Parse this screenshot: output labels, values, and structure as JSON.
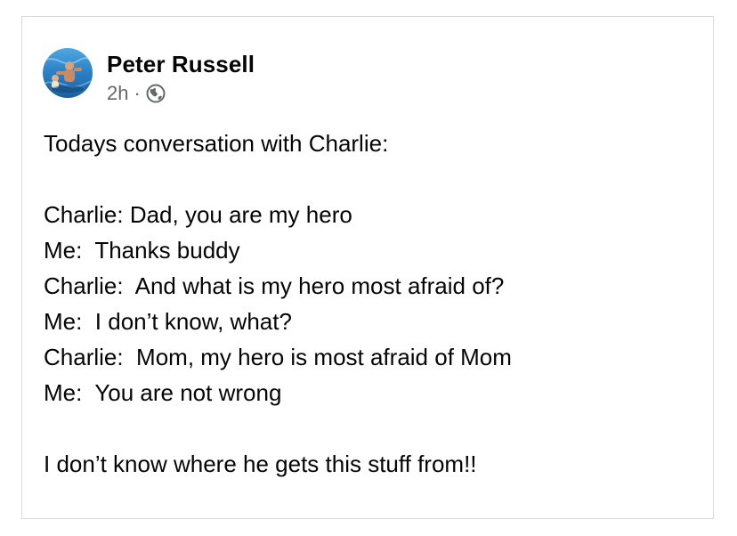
{
  "post": {
    "author": "Peter Russell",
    "timestamp": "2h",
    "separator": "·",
    "audience_icon": "globe-icon",
    "body_lines": [
      "Todays conversation with Charlie:",
      "",
      "Charlie: Dad, you are my hero",
      "Me:  Thanks buddy",
      "Charlie:  And what is my hero most afraid of?",
      "Me:  I don’t know, what?",
      "Charlie:  Mom, my hero is most afraid of Mom",
      "Me:  You are not wrong",
      "",
      "I don’t know where he gets this stuff from!!"
    ]
  },
  "colors": {
    "text": "#050505",
    "secondary_text": "#65676b",
    "border": "#d9d9d9",
    "avatar_water": "#2a7fc4"
  }
}
